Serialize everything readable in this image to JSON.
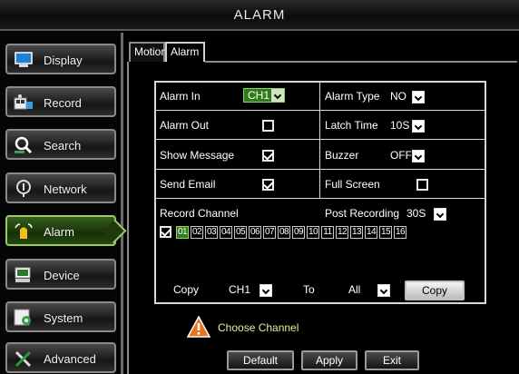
{
  "window": {
    "title": "ALARM"
  },
  "sidebar": {
    "items": [
      {
        "label": "Display",
        "icon": "display-icon"
      },
      {
        "label": "Record",
        "icon": "record-icon"
      },
      {
        "label": "Search",
        "icon": "search-icon"
      },
      {
        "label": "Network",
        "icon": "network-icon"
      },
      {
        "label": "Alarm",
        "icon": "alarm-icon",
        "active": true
      },
      {
        "label": "Device",
        "icon": "device-icon"
      },
      {
        "label": "System",
        "icon": "system-icon"
      },
      {
        "label": "Advanced",
        "icon": "advanced-icon"
      }
    ]
  },
  "tabs": [
    {
      "label": "Motion",
      "active": false
    },
    {
      "label": "Alarm",
      "active": true
    }
  ],
  "form": {
    "alarm_in": {
      "label": "Alarm In",
      "value": "CH1"
    },
    "alarm_type": {
      "label": "Alarm Type",
      "value": "NO"
    },
    "alarm_out": {
      "label": "Alarm Out",
      "checked": false
    },
    "latch_time": {
      "label": "Latch Time",
      "value": "10S"
    },
    "show_message": {
      "label": "Show Message",
      "checked": true
    },
    "buzzer": {
      "label": "Buzzer",
      "value": "OFF"
    },
    "send_email": {
      "label": "Send Email",
      "checked": true
    },
    "full_screen": {
      "label": "Full Screen",
      "checked": false
    },
    "record_channel": {
      "label": "Record Channel"
    },
    "post_recording": {
      "label": "Post Recording",
      "value": "30S"
    },
    "channels": [
      "01",
      "02",
      "03",
      "04",
      "05",
      "06",
      "07",
      "08",
      "09",
      "10",
      "11",
      "12",
      "13",
      "14",
      "15",
      "16"
    ],
    "selected_channel": "01"
  },
  "copy": {
    "label": "Copy",
    "from": "CH1",
    "to_label": "To",
    "to": "All",
    "button": "Copy"
  },
  "warning": {
    "text": "Choose Channel"
  },
  "footer": {
    "default_label": "Default",
    "apply_label": "Apply",
    "exit_label": "Exit"
  },
  "colors": {
    "selected_green": "#2f7d1a",
    "warning_text": "#e9f09a",
    "warning_icon": "#e8741c"
  }
}
